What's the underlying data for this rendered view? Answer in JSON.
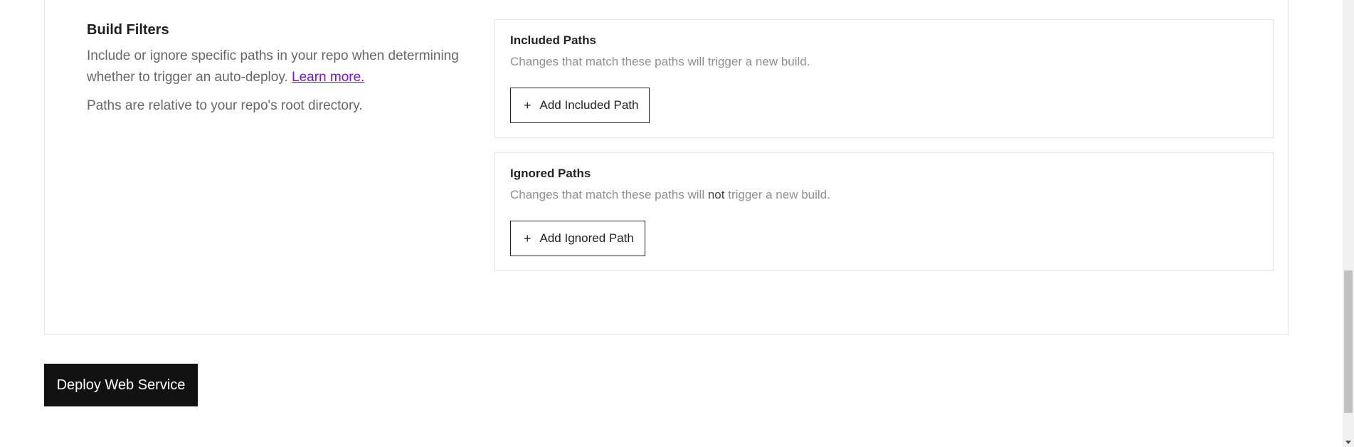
{
  "build_filters": {
    "title": "Build Filters",
    "description": "Include or ignore specific paths in your repo when determining whether to trigger an auto-deploy.",
    "learn_more": "Learn more.",
    "note": "Paths are relative to your repo's root directory."
  },
  "included_paths": {
    "title": "Included Paths",
    "description": "Changes that match these paths will trigger a new build.",
    "button_label": "Add Included Path",
    "button_icon": "plus-icon"
  },
  "ignored_paths": {
    "title": "Ignored Paths",
    "description_before": "Changes that match these paths will",
    "description_emphasis": "not",
    "description_after": "trigger a new build.",
    "button_label": "Add Ignored Path",
    "button_icon": "plus-icon"
  },
  "footer": {
    "deploy_label": "Deploy Web Service"
  },
  "colors": {
    "link": "#7a14d9",
    "primary_button": "#121212",
    "muted_text": "#8f8f8f"
  }
}
